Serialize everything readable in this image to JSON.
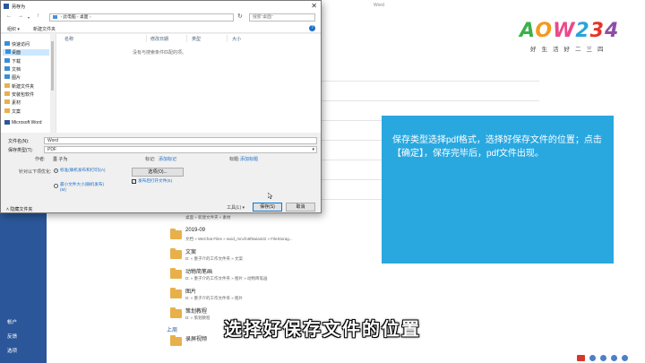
{
  "word_backstage": {
    "title_fragment": "Word",
    "rail": [
      "帐户",
      "反馈",
      "选项"
    ],
    "folders": [
      {
        "name": "",
        "path": "桌面 » 新建文件夹 » 素材"
      },
      {
        "name": "2019-09",
        "path": "文档 » WeChat Files » wxid_mncfo6f5wia422 » FileStorag..."
      },
      {
        "name": "文案",
        "path": "D: » 墨子介的工作文件夹 » 文案"
      },
      {
        "name": "动物简笔画",
        "path": "D: » 墨子介的工作文件夹 » 图片 » 动物简笔画"
      },
      {
        "name": "图片",
        "path": "D: » 墨子介的工作文件夹 » 图片"
      },
      {
        "name": "策划教程",
        "path": "D: » 策划教程"
      },
      {
        "name": "录屏视频",
        "path": ""
      }
    ],
    "group_label": "上周"
  },
  "logo": {
    "word": "AOW234",
    "sub": "好生活好二三四"
  },
  "callout": {
    "text": "保存类型选择pdf格式，选择好保存文件的位置；点击【确定】，保存完毕后，pdf文件出现。"
  },
  "caption": "选择好保存文件的位置",
  "dialog": {
    "title": "另存为",
    "close": "✕",
    "nav": {
      "back": "←",
      "forward": "→",
      "up": "↑"
    },
    "address": [
      "此电脑",
      "桌面"
    ],
    "search_placeholder": "搜索\"桌面\"",
    "toolbar": {
      "organize": "组织 ▾",
      "new_folder": "新建文件夹",
      "help": "?"
    },
    "nav_pane": [
      {
        "label": "快速访问",
        "kind": "star"
      },
      {
        "label": "桌面",
        "kind": "sel"
      },
      {
        "label": "下载",
        "kind": "blue"
      },
      {
        "label": "文档",
        "kind": "blue"
      },
      {
        "label": "图片",
        "kind": "blue"
      },
      {
        "label": "新建文件夹",
        "kind": "folder"
      },
      {
        "label": "安装包软件",
        "kind": "folder"
      },
      {
        "label": "素材",
        "kind": "folder"
      },
      {
        "label": "文案",
        "kind": "folder"
      },
      {
        "label": "Microsoft Word",
        "kind": "word"
      }
    ],
    "columns": [
      "名称",
      "修改日期",
      "类型",
      "大小"
    ],
    "empty_message": "没有与搜索条件匹配的项。",
    "filename_label": "文件名(N):",
    "filename_value": "Word",
    "filetype_label": "保存类型(T):",
    "filetype_value": "PDF",
    "authors_label": "作者:",
    "authors_value": "墨 子为",
    "tags_label": "标记:",
    "tags_value": "添加标记",
    "title_label": "标题:",
    "title_value": "添加标题",
    "optimize_label": "针对以下项优化:",
    "option_standard": "标准(联机发布和打印)(A)",
    "option_minimum": "最小文件大小(联机发布)(M)",
    "options_button": "选项(O)...",
    "open_after_label": "发布后打开文件(E)",
    "open_after_mark": "✓",
    "hide_folders": "隐藏文件夹",
    "tools_button": "工具(L) ▾",
    "save_button": "保存(S)",
    "cancel_button": "取消"
  }
}
